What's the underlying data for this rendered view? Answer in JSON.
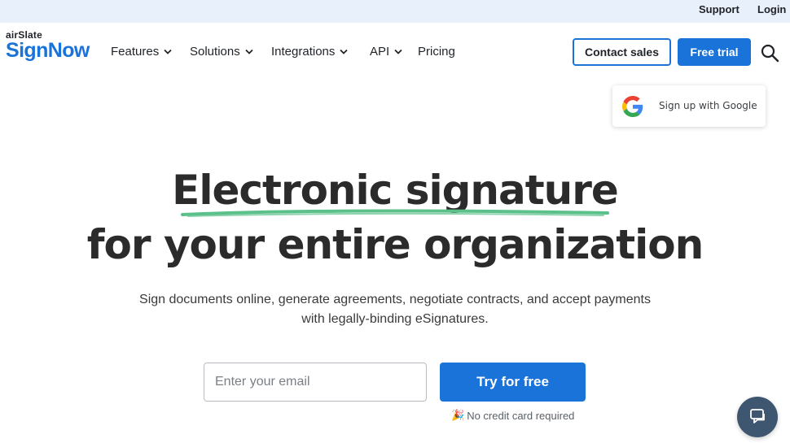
{
  "topbar": {
    "support": "Support",
    "login": "Login"
  },
  "logo": {
    "small": "airSlate",
    "big": "SignNow"
  },
  "nav": {
    "items": [
      {
        "label": "Features",
        "dropdown": true
      },
      {
        "label": "Solutions",
        "dropdown": true
      },
      {
        "label": "Integrations",
        "dropdown": true
      },
      {
        "label": "API",
        "dropdown": true
      },
      {
        "label": "Pricing",
        "dropdown": false
      }
    ]
  },
  "header": {
    "contact_sales": "Contact sales",
    "free_trial": "Free trial",
    "search_icon": "search-icon"
  },
  "google_popup": {
    "label": "Sign up with Google",
    "icon": "google-g-icon"
  },
  "hero": {
    "title_line1": "Electronic signature",
    "title_line2": "for your entire organization",
    "subtitle_line1": "Sign documents online, generate agreements, negotiate contracts, and accept payments",
    "subtitle_line2": "with legally-binding eSignatures."
  },
  "signup": {
    "email_placeholder": "Enter your email",
    "email_value": "",
    "cta": "Try for free",
    "no_card": "No credit card required",
    "no_card_icon": "party-popper-icon"
  },
  "chat": {
    "icon": "chat-icon"
  },
  "colors": {
    "brand_blue": "#1a73d9",
    "topbar_bg": "#e8f0fb",
    "underline_green": "#5cc08a",
    "chat_bg": "#3f5670"
  }
}
